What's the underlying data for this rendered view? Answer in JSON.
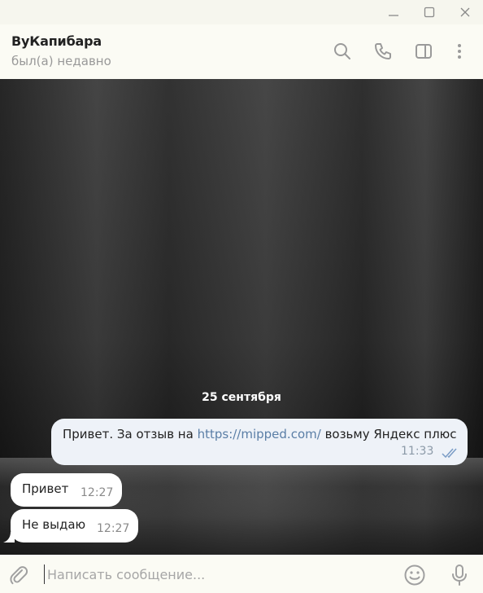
{
  "window": {
    "controls": [
      "minimize-icon",
      "maximize-icon",
      "close-icon"
    ]
  },
  "header": {
    "name": "ВуКапибара",
    "status": "был(а) недавно",
    "icons": [
      "search-icon",
      "phone-icon",
      "sidebar-panel-icon",
      "more-vertical-icon"
    ]
  },
  "chat": {
    "date": "25 сентября",
    "messages": [
      {
        "direction": "out",
        "text_before": "Привет. За отзыв на ",
        "link": "https://mipped.com/",
        "text_after": " возьму Яндекс плюс",
        "time": "11:33",
        "status_icon": "double-check-icon"
      },
      {
        "direction": "in",
        "text": "Привет",
        "time": "12:27"
      },
      {
        "direction": "in",
        "text": "Не выдаю",
        "time": "12:27"
      }
    ]
  },
  "composer": {
    "placeholder": "Написать сообщение...",
    "icons": [
      "paperclip-icon",
      "emoji-icon",
      "microphone-icon"
    ]
  },
  "colors": {
    "outgoing_bubble": "#eef2f8",
    "incoming_bubble": "#ffffff",
    "link": "#5a7ea6",
    "header_bg": "#fbfbf4"
  }
}
